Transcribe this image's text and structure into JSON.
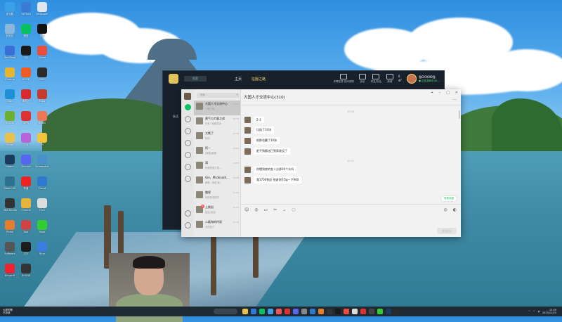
{
  "desktop_icons": [
    {
      "label": "此电脑",
      "color": "#3aa0e8"
    },
    {
      "label": "GeForce",
      "color": "#3a7bd5"
    },
    {
      "label": "Wallpaper",
      "color": "#e0e6f0"
    },
    {
      "label": "回收站",
      "color": "#8ab8dc"
    },
    {
      "label": "微信",
      "color": "#07c160"
    },
    {
      "label": "剪映",
      "color": "#111111"
    },
    {
      "label": "SoloDesk",
      "color": "#3b6fd8"
    },
    {
      "label": "QQ",
      "color": "#1a1a1a"
    },
    {
      "label": "Game",
      "color": "#ec4c3c"
    },
    {
      "label": "Chrome",
      "color": "#e9b52c"
    },
    {
      "label": "KOOK",
      "color": "#f15a22"
    },
    {
      "label": "OBS",
      "color": "#2b2b2b"
    },
    {
      "label": "Edge",
      "color": "#1e90d6"
    },
    {
      "label": "网易云",
      "color": "#d92b2b"
    },
    {
      "label": "Pubg",
      "color": "#c63b2c"
    },
    {
      "label": "NVIDIA",
      "color": "#6cb02e"
    },
    {
      "label": "WPS",
      "color": "#d33"
    },
    {
      "label": "Bilibili",
      "color": "#e75"
    },
    {
      "label": "Folder",
      "color": "#e8c04a"
    },
    {
      "label": "Cat",
      "color": "#b565d8"
    },
    {
      "label": "YY",
      "color": "#f3c33a"
    },
    {
      "label": "Steam",
      "color": "#1b3a5c"
    },
    {
      "label": "Discord",
      "color": "#5865f2"
    },
    {
      "label": "Screenshot",
      "color": "#4a90c8"
    },
    {
      "label": "Steam VR",
      "color": "#2f6f8f"
    },
    {
      "label": "有道",
      "color": "#e22"
    },
    {
      "label": "Cloud",
      "color": "#2f78d0"
    },
    {
      "label": "OBS Studio",
      "color": "#333"
    },
    {
      "label": "Chrome",
      "color": "#e6b43a"
    },
    {
      "label": "Dice",
      "color": "#ddd"
    },
    {
      "label": "Photo",
      "color": "#e77d2c"
    },
    {
      "label": "Tool",
      "color": "#c44"
    },
    {
      "label": "Mask",
      "color": "#3c3"
    },
    {
      "label": "Software",
      "color": "#555"
    },
    {
      "label": "ZZZ",
      "color": "#1c1c1c"
    },
    {
      "label": "Blue",
      "color": "#3a7de0"
    },
    {
      "label": "Kingsoft",
      "color": "#e23"
    },
    {
      "label": "NVIDIA",
      "color": "#333"
    }
  ],
  "launcher": {
    "search": "搜索",
    "tabs": [
      "主页",
      "征服之路"
    ],
    "icons": [
      "本周任务·总体说明",
      "活动",
      "好友/队伍",
      "商城"
    ],
    "coins": [
      "0",
      "47"
    ],
    "player_name": "强GYX690强",
    "player_status": "● 正在游戏中(大…",
    "sidebar_label": "队伍"
  },
  "chat": {
    "search_placeholder": "搜索",
    "title": "大国人才交流中心(310)",
    "conversations": [
      {
        "name": "大国人才交流中心",
        "preview": "一眼丁真",
        "time": "13:49",
        "selected": true,
        "badge": ""
      },
      {
        "name": "黄气与力量之战",
        "preview": "已有人领取成功",
        "time": "13:33",
        "selected": false,
        "badge": ""
      },
      {
        "name": "大熊了",
        "preview": "好的",
        "time": "13:30",
        "selected": false,
        "badge": ""
      },
      {
        "name": "阿一",
        "preview": "[转账]谢谢",
        "time": "13:05",
        "selected": false,
        "badge": ""
      },
      {
        "name": "渴",
        "preview": "你就知道下载…",
        "time": "12:58",
        "selected": false,
        "badge": ""
      },
      {
        "name": "Gin、Mcdonald…",
        "preview": "我就…你说,我…",
        "time": "12:28",
        "selected": false,
        "badge": ""
      },
      {
        "name": "傲视",
        "preview": "好的好的好的",
        "time": "11:56",
        "selected": false,
        "badge": ""
      },
      {
        "name": "土拨鼠",
        "preview": "加油,加油..",
        "time": "11:43",
        "selected": false,
        "badge": "2"
      },
      {
        "name": "二级海的传说",
        "preview": "去吃饭了",
        "time": "11:12",
        "selected": false,
        "badge": ""
      }
    ],
    "timestamps": [
      "13:28",
      "13:41"
    ],
    "messages_a": [
      "2-3",
      "垃圾了10块",
      "他那也赢了10块",
      "赶不到都送已到家收没了"
    ],
    "messages_b": [
      "你懂到底的女十分钟20个头吗",
      "我1700到血 他说你们5g一下900"
    ],
    "new_msg_pill": "有新消息",
    "send_label": "发送(S)",
    "toolbar": [
      "☺",
      "◎",
      "▭",
      "✂",
      "⌄",
      "◌"
    ]
  },
  "taskbar": {
    "weather_line1": "大雾预警",
    "weather_line2": "已持续",
    "time": "13:49",
    "date": "2023/11/25"
  }
}
